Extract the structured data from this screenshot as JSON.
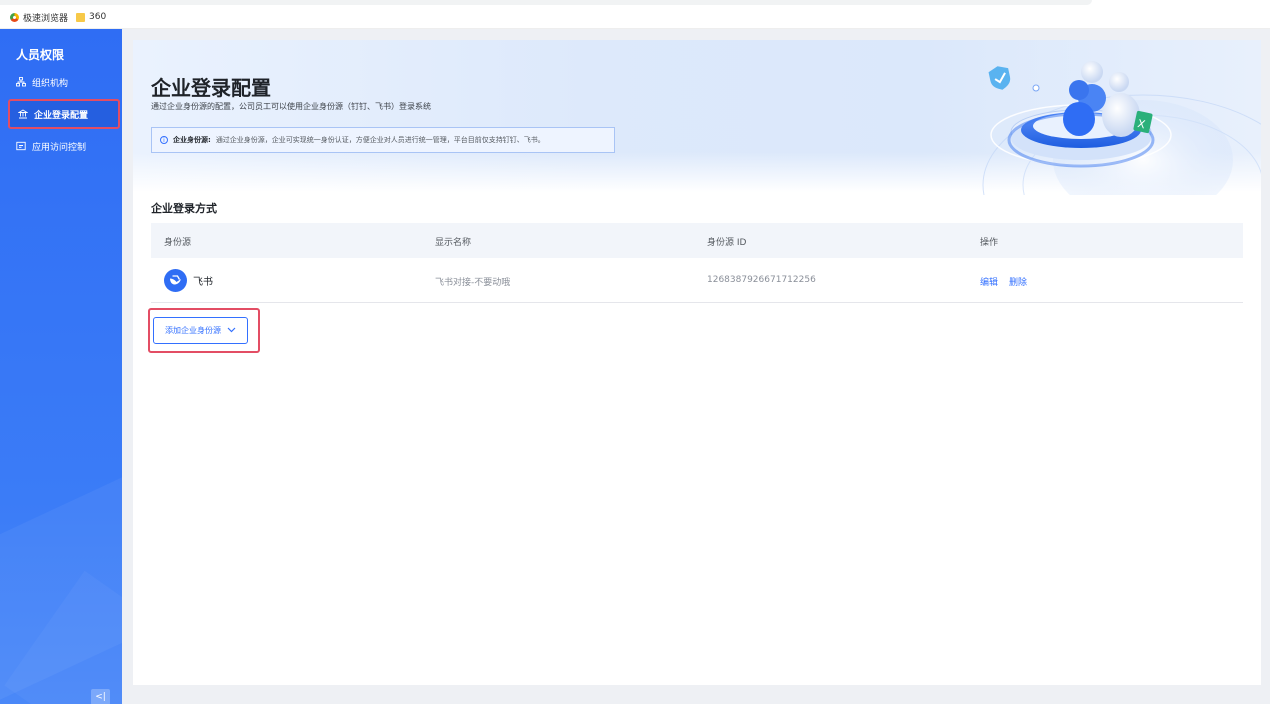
{
  "browser": {
    "bookmarks": [
      {
        "label": "极速浏览器",
        "icon": "extension-icon"
      },
      {
        "label": "360",
        "icon": "folder-icon"
      }
    ]
  },
  "sidebar": {
    "title": "人员权限",
    "items": [
      {
        "label": "组织机构",
        "icon": "org-tree-icon",
        "active": false
      },
      {
        "label": "企业登录配置",
        "icon": "bank-icon",
        "active": true
      },
      {
        "label": "应用访问控制",
        "icon": "app-window-icon",
        "active": false
      }
    ],
    "collapse_label": "<|"
  },
  "page": {
    "title": "企业登录配置",
    "description": "通过企业身份源的配置，公司员工可以使用企业身份源（钉钉、飞书）登录系统",
    "notice": {
      "label": "企业身份源:",
      "text": "通过企业身份源，企业可实现统一身份认证，方便企业对人员进行统一管理，平台目前仅支持钉钉、飞书。"
    },
    "section_title": "企业登录方式"
  },
  "table": {
    "headers": [
      "身份源",
      "显示名称",
      "身份源 ID",
      "操作"
    ],
    "rows": [
      {
        "source": "飞书",
        "display_name": "飞书对接-不要动哦",
        "source_id": "1268387926671712256",
        "actions": [
          "编辑",
          "删除"
        ]
      }
    ]
  },
  "add_button": {
    "label": "添加企业身份源"
  },
  "colors": {
    "sidebar": "#2f6df4",
    "accent": "#3370ff",
    "highlight_border": "#e34d64"
  }
}
